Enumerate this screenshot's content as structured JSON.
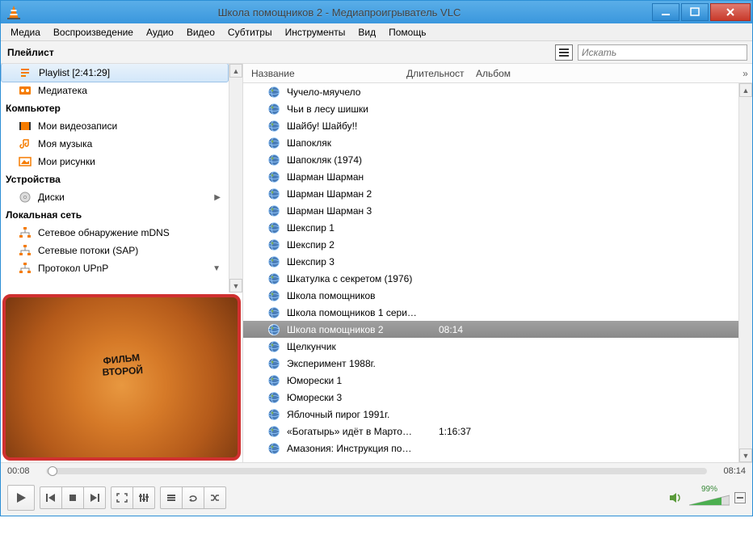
{
  "window": {
    "title": "Школа помощников 2 - Медиапроигрыватель VLC"
  },
  "menu": {
    "media": "Медиа",
    "playback": "Воспроизведение",
    "audio": "Аудио",
    "video": "Видео",
    "subs": "Субтитры",
    "tools": "Инструменты",
    "view": "Вид",
    "help": "Помощь"
  },
  "toolbar": {
    "playlist_label": "Плейлист",
    "search_placeholder": "Искать"
  },
  "sidebar": {
    "playlist_item": "Playlist [2:41:29]",
    "library": "Медиатека",
    "cat_computer": "Компьютер",
    "videos": "Мои видеозаписи",
    "music": "Моя музыка",
    "pictures": "Мои рисунки",
    "cat_devices": "Устройства",
    "discs": "Диски",
    "cat_network": "Локальная сеть",
    "mdns": "Сетевое обнаружение mDNS",
    "sap": "Сетевые потоки (SAP)",
    "upnp": "Протокол UPnP"
  },
  "preview": {
    "line1": "ФИЛЬМ",
    "line2": "ВТОРОЙ"
  },
  "columns": {
    "title": "Название",
    "duration": "Длительност",
    "album": "Альбом"
  },
  "playlist_items": [
    {
      "title": "Чучело-мяучело",
      "duration": ""
    },
    {
      "title": "Чьи в лесу шишки",
      "duration": ""
    },
    {
      "title": "Шайбу! Шайбу!!",
      "duration": ""
    },
    {
      "title": "Шапокляк",
      "duration": ""
    },
    {
      "title": "Шапокляк (1974)",
      "duration": ""
    },
    {
      "title": "Шарман Шарман",
      "duration": ""
    },
    {
      "title": "Шарман Шарман 2",
      "duration": ""
    },
    {
      "title": "Шарман Шарман 3",
      "duration": ""
    },
    {
      "title": "Шекспир 1",
      "duration": ""
    },
    {
      "title": "Шекспир 2",
      "duration": ""
    },
    {
      "title": "Шекспир 3",
      "duration": ""
    },
    {
      "title": "Шкатулка с секретом (1976)",
      "duration": ""
    },
    {
      "title": "Школа помощников",
      "duration": ""
    },
    {
      "title": "Школа помощников 1 сери…",
      "duration": ""
    },
    {
      "title": "Школа помощников 2",
      "duration": "08:14"
    },
    {
      "title": "Щелкунчик",
      "duration": ""
    },
    {
      "title": "Эксперимент 1988г.",
      "duration": ""
    },
    {
      "title": "Юморески 1",
      "duration": ""
    },
    {
      "title": "Юморески 3",
      "duration": ""
    },
    {
      "title": "Яблочный пирог 1991г.",
      "duration": ""
    },
    {
      "title": "«Богатырь» идёт в Марто…",
      "duration": "1:16:37"
    },
    {
      "title": "Амазония: Инструкция по…",
      "duration": ""
    }
  ],
  "playlist_selected_index": 14,
  "player": {
    "time_current": "00:08",
    "time_total": "08:14",
    "volume_pct": "99%"
  }
}
